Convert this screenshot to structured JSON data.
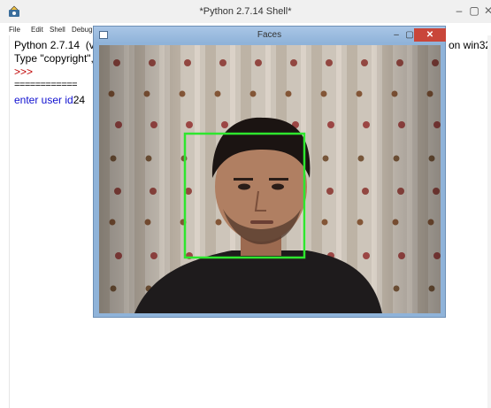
{
  "shell": {
    "title": "*Python 2.7.14 Shell*",
    "menu": [
      "File",
      "Edit",
      "Shell",
      "Debug"
    ],
    "lines": {
      "line1": "Python 2.7.14  (v",
      "line1_right": "on win32",
      "line2": "Type \"copyright\",",
      "prompt": ">>>",
      "separator": "============",
      "input_label": "enter user id",
      "input_value": "24"
    },
    "window_controls": {
      "minimize": "–",
      "maximize": "▢",
      "close": "✕"
    }
  },
  "faces_window": {
    "title": "Faces",
    "window_controls": {
      "minimize": "–",
      "maximize": "▢",
      "close": "✕"
    },
    "detection_box_color": "#2ee62e"
  },
  "colors": {
    "prompt": "#c00000",
    "user_input": "#1010d0",
    "close_button": "#c9463a",
    "faces_frame": "#8fb3d9"
  }
}
